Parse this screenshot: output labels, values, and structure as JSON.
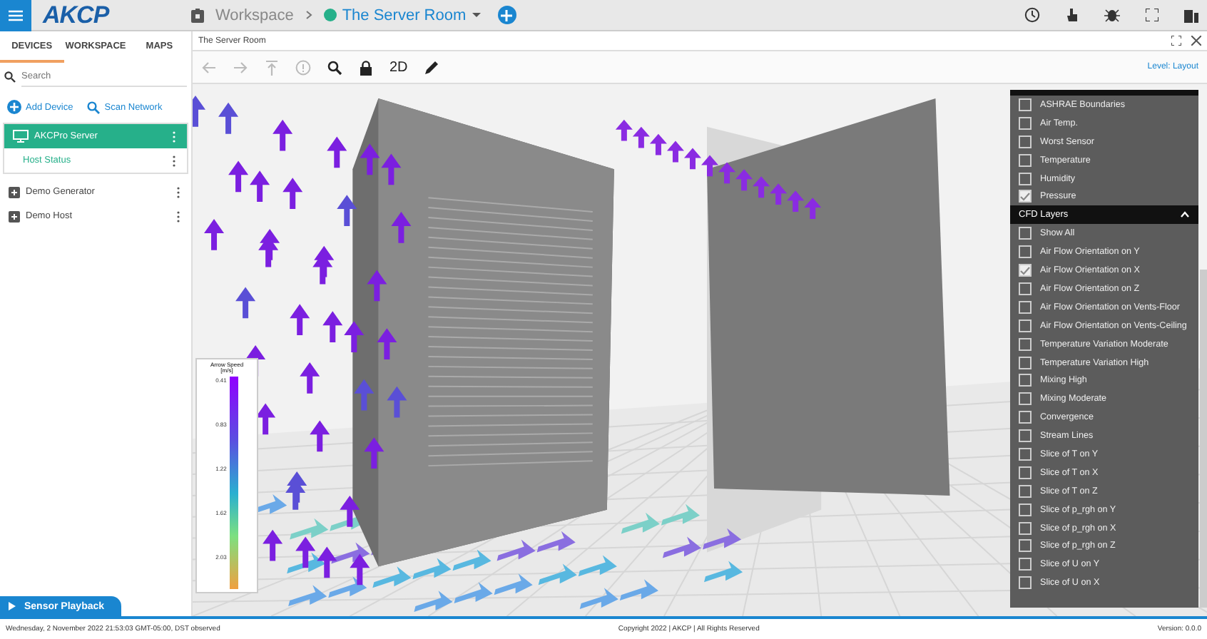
{
  "header": {
    "logo": "AKCP",
    "breadcrumb": [
      {
        "label": "Workspace",
        "kind": "link"
      },
      {
        "label": "The Server Room",
        "kind": "current"
      }
    ]
  },
  "sidebar": {
    "tabs": [
      {
        "label": "DEVICES",
        "selected": true
      },
      {
        "label": "WORKSPACE",
        "selected": false
      },
      {
        "label": "MAPS",
        "selected": false
      }
    ],
    "search": {
      "placeholder": "Search"
    },
    "actions": [
      {
        "label": "Add Device",
        "kind": "add"
      },
      {
        "label": "Scan Network",
        "kind": "scan"
      }
    ],
    "tree": [
      {
        "label": "AKCPro Server",
        "selected": true,
        "expanded": true,
        "children": [
          {
            "label": "Host Status",
            "selected": false
          }
        ]
      },
      {
        "label": "Demo Generator",
        "selected": false,
        "expanded": false
      },
      {
        "label": "Demo Host",
        "selected": false,
        "expanded": false
      }
    ]
  },
  "viewer": {
    "title": "The Server Room",
    "tools": [
      {
        "kind": "back",
        "disabled": true
      },
      {
        "kind": "forward",
        "disabled": true
      },
      {
        "kind": "top",
        "disabled": true
      },
      {
        "kind": "info",
        "disabled": true
      },
      {
        "kind": "search",
        "disabled": false
      },
      {
        "kind": "lock",
        "disabled": false
      },
      {
        "kind": "text",
        "label": "2D",
        "disabled": false
      },
      {
        "kind": "pencil",
        "disabled": false
      }
    ],
    "level_label": "Level: Layout",
    "legend": {
      "title": "Arrow Speed [m/s]",
      "ticks": [
        "0.41",
        "0.83",
        "1.22",
        "1.62",
        "2.03"
      ]
    },
    "layer_groups": [
      {
        "expanded": true,
        "items": [
          {
            "label": "ASHRAE Boundaries",
            "checked": false
          },
          {
            "label": "Air Temp.",
            "checked": false
          },
          {
            "label": "Worst Sensor",
            "checked": false
          },
          {
            "label": "Temperature",
            "checked": false
          },
          {
            "label": "Humidity",
            "checked": false
          },
          {
            "label": "Pressure",
            "checked": true
          }
        ]
      },
      {
        "title": "CFD Layers",
        "expanded": true,
        "items": [
          {
            "label": "Show All",
            "checked": false
          },
          {
            "label": "Air Flow Orientation on Y",
            "checked": false
          },
          {
            "label": "Air Flow Orientation on X",
            "checked": true
          },
          {
            "label": "Air Flow Orientation on Z",
            "checked": false
          },
          {
            "label": "Air Flow Orientation on Vents-Floor",
            "checked": false
          },
          {
            "label": "Air Flow Orientation on Vents-Ceiling",
            "checked": false
          },
          {
            "label": "Temperature Variation Moderate",
            "checked": false
          },
          {
            "label": "Temperature Variation High",
            "checked": false
          },
          {
            "label": "Mixing High",
            "checked": false
          },
          {
            "label": "Mixing Moderate",
            "checked": false
          },
          {
            "label": "Convergence",
            "checked": false
          },
          {
            "label": "Stream Lines",
            "checked": false
          },
          {
            "label": "Slice of T on Y",
            "checked": false
          },
          {
            "label": "Slice of T on X",
            "checked": false
          },
          {
            "label": "Slice of T on Z",
            "checked": false
          },
          {
            "label": "Slice of p_rgh on Y",
            "checked": false
          },
          {
            "label": "Slice of p_rgh on X",
            "checked": false
          },
          {
            "label": "Slice of p_rgh on Z",
            "checked": false
          },
          {
            "label": "Slice of U on Y",
            "checked": false
          },
          {
            "label": "Slice of U on X",
            "checked": false
          }
        ]
      }
    ]
  },
  "playback": {
    "label": "Sensor Playback"
  },
  "footer": {
    "datetime": "Wednesday, 2 November 2022 21:53:03 GMT-05:00, DST observed",
    "copyright": "Copyright 2022 | AKCP | All Rights Reserved",
    "version": "Version: 0.0.0"
  }
}
